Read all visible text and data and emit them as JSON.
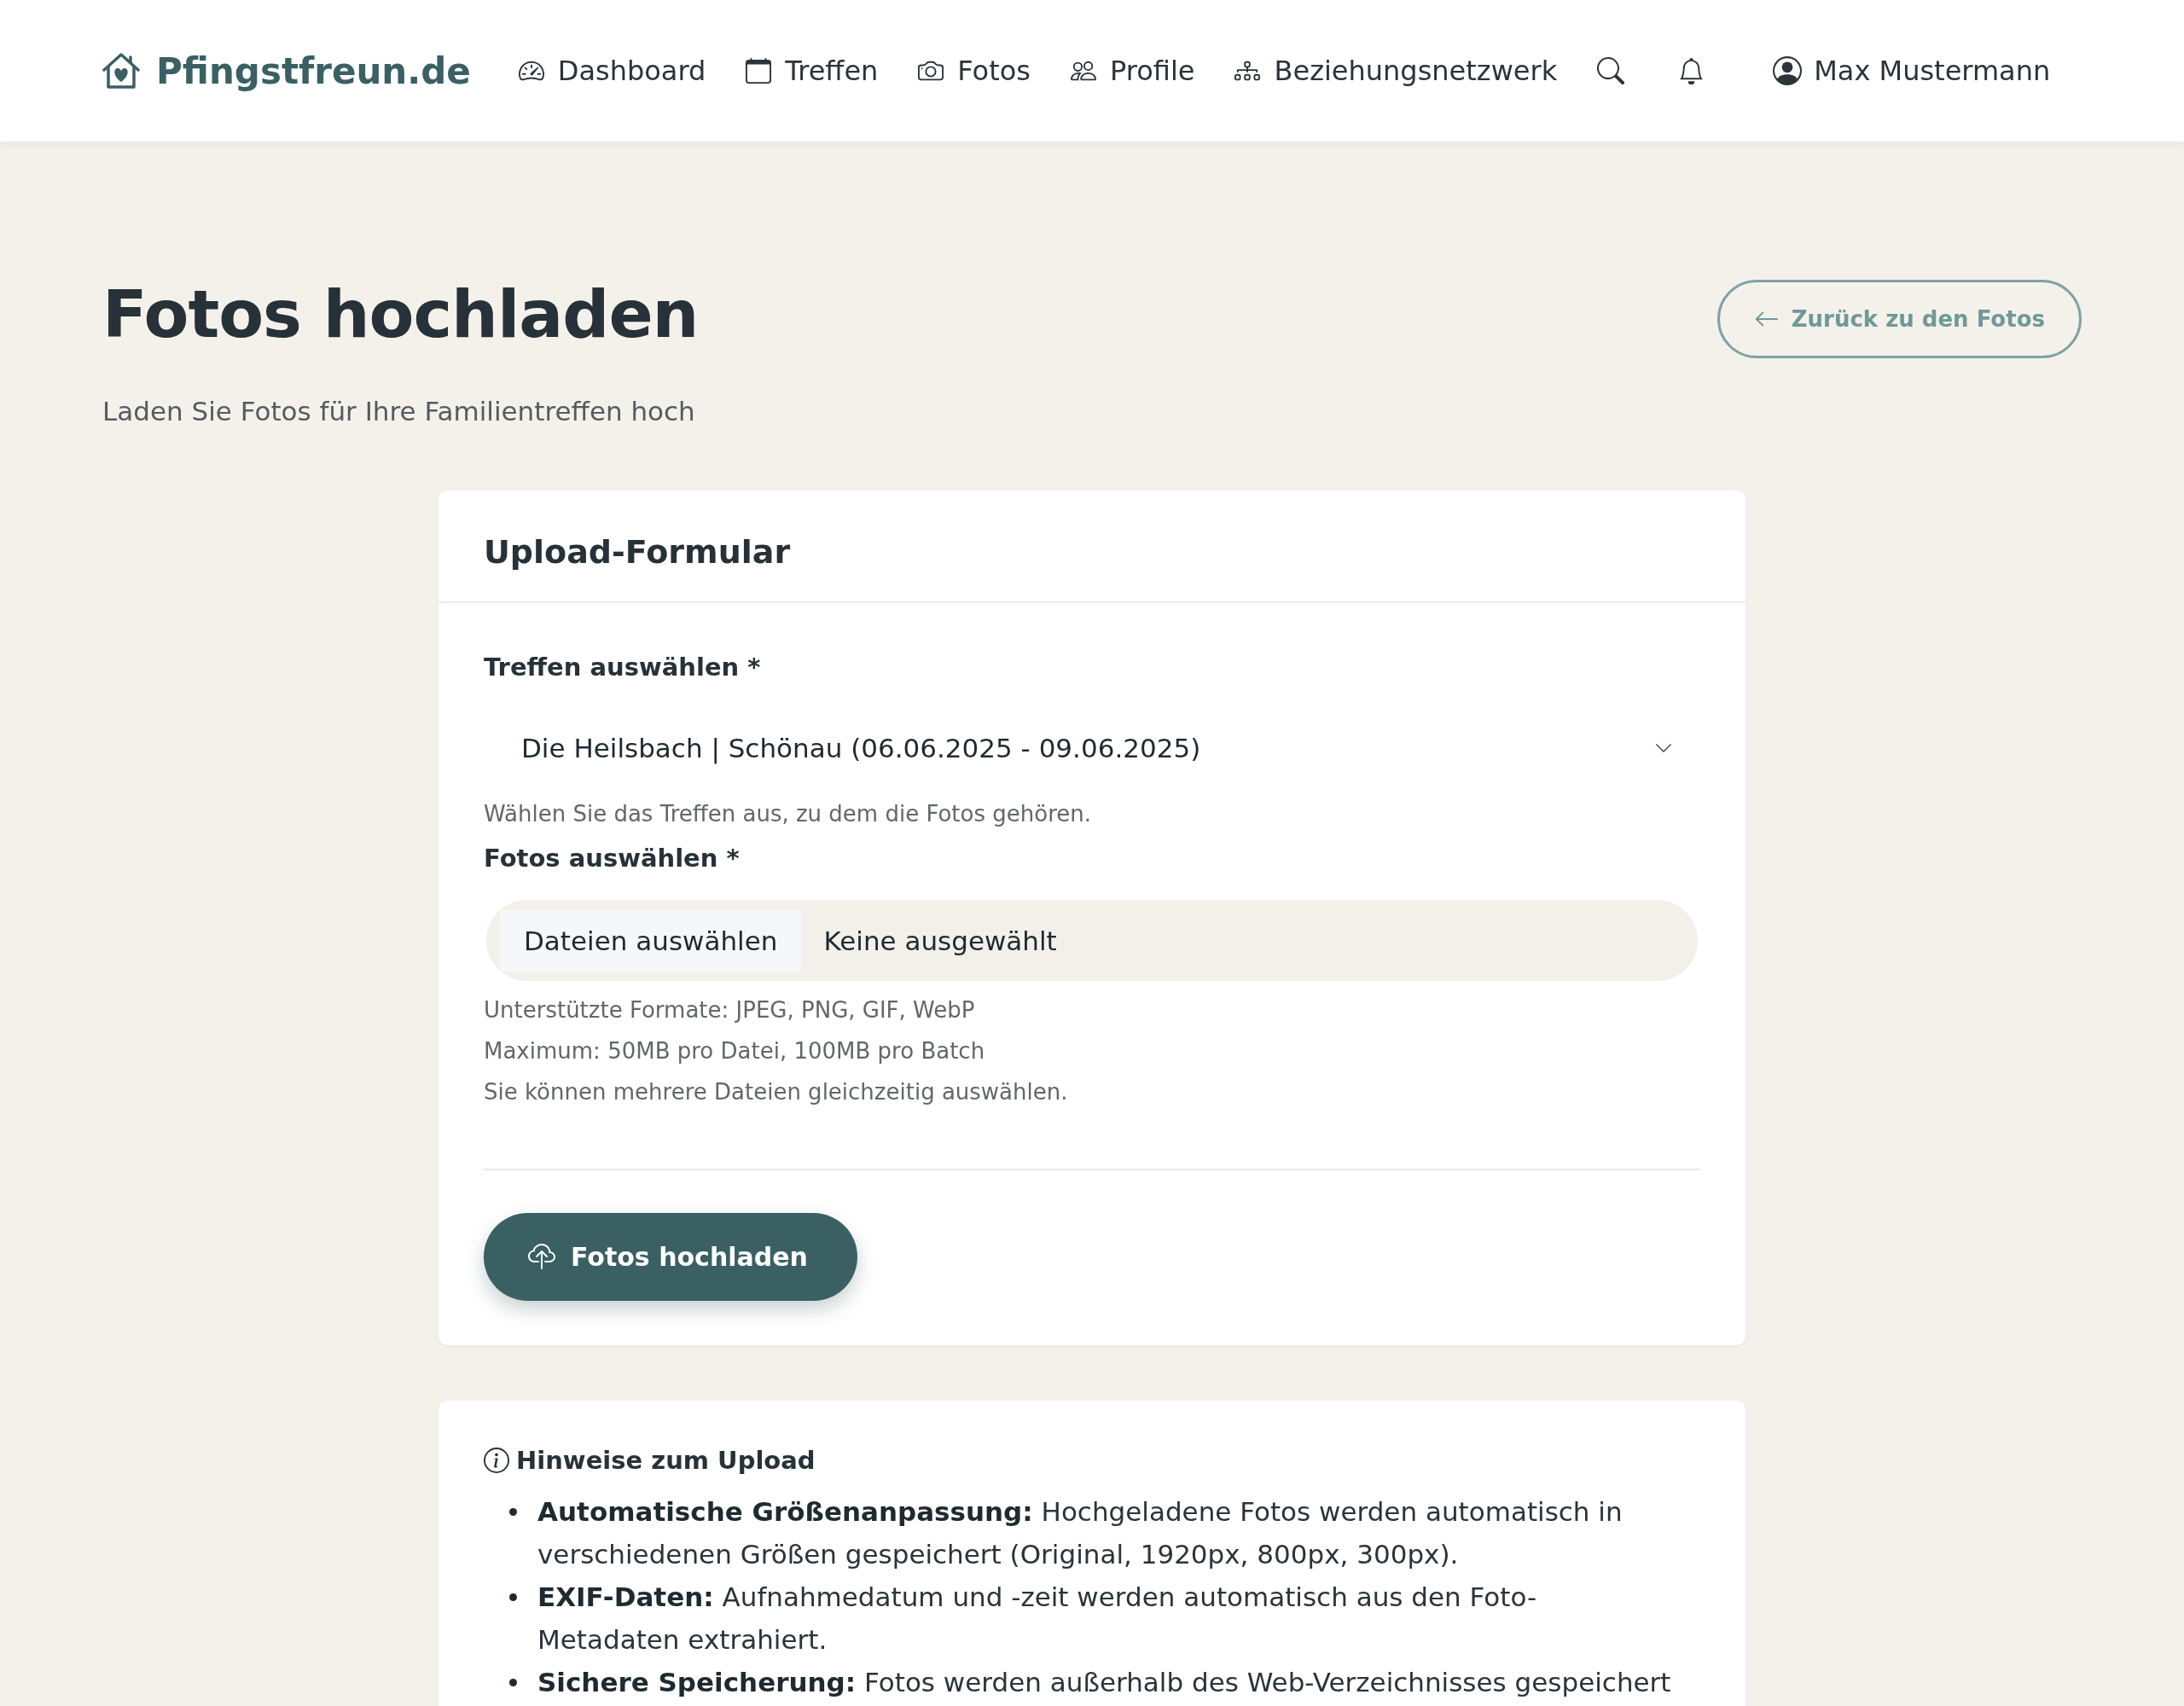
{
  "header": {
    "logo": "Pfingstfreun.de",
    "nav": [
      "Dashboard",
      "Treffen",
      "Fotos",
      "Profile",
      "Beziehungsnetzwerk"
    ],
    "user": "Max Mustermann"
  },
  "page": {
    "title": "Fotos hochladen",
    "subtitle": "Laden Sie Fotos für Ihre Familientreffen hoch",
    "back_button": "Zurück zu den Fotos"
  },
  "form": {
    "title": "Upload-Formular",
    "meeting": {
      "label": "Treffen auswählen *",
      "value": "Die Heilsbach | Schönau (06.06.2025 - 09.06.2025)",
      "help": "Wählen Sie das Treffen aus, zu dem die Fotos gehören."
    },
    "photos": {
      "label": "Fotos auswählen *",
      "button": "Dateien auswählen",
      "status": "Keine ausgewählt",
      "help": [
        "Unterstützte Formate: JPEG, PNG, GIF, WebP",
        "Maximum: 50MB pro Datei, 100MB pro Batch",
        "Sie können mehrere Dateien gleichzeitig auswählen."
      ]
    },
    "submit": "Fotos hochladen"
  },
  "hints": {
    "title": "Hinweise zum Upload",
    "items": [
      "**Automatische Größenanpassung:** Hochgeladene Fotos werden automatisch in verschiedenen Größen gespeichert (Original, 1920px, 800px, 300px).",
      "**EXIF-Daten:** Aufnahmedatum und -zeit werden automatisch aus den Foto-Metadaten extrahiert.",
      "**Sichere Speicherung:** Fotos werden außerhalb des Web-Verzeichnisses gespeichert"
    ]
  }
}
